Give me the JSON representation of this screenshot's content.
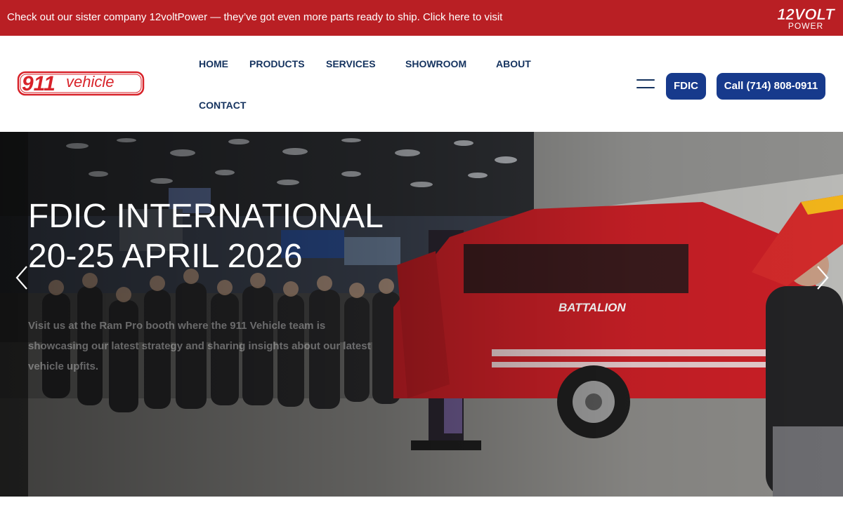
{
  "promo": {
    "text": "Check out our sister company 12voltPower — they’ve got even more parts ready to ship. Click here to visit",
    "logo_main": "12VOLT",
    "logo_sub": "POWER"
  },
  "logo": {
    "number": "911",
    "word": "vehicle"
  },
  "nav": {
    "home": "HOME",
    "products": "PRODUCTS",
    "services": "SERVICES",
    "showroom": "SHOWROOM",
    "about": "ABOUT",
    "contact": "CONTACT"
  },
  "buttons": {
    "fdic": "FDIC",
    "call": "Call (714) 808-0911"
  },
  "hero": {
    "title_line1": "FDIC INTERNATIONAL",
    "title_line2": "20-25 APRIL 2026",
    "description": "Visit us at the Ram Pro booth where the 911 Vehicle team is showcasing our latest strategy and sharing insights about our latest vehicle upfits."
  },
  "colors": {
    "promo_bg": "#b91f24",
    "nav_text": "#15335f",
    "button_bg": "#173a8c",
    "logo_red": "#d8232a"
  },
  "icons": {
    "menu": "hamburger-icon",
    "prev": "chevron-left-icon",
    "next": "chevron-right-icon"
  }
}
